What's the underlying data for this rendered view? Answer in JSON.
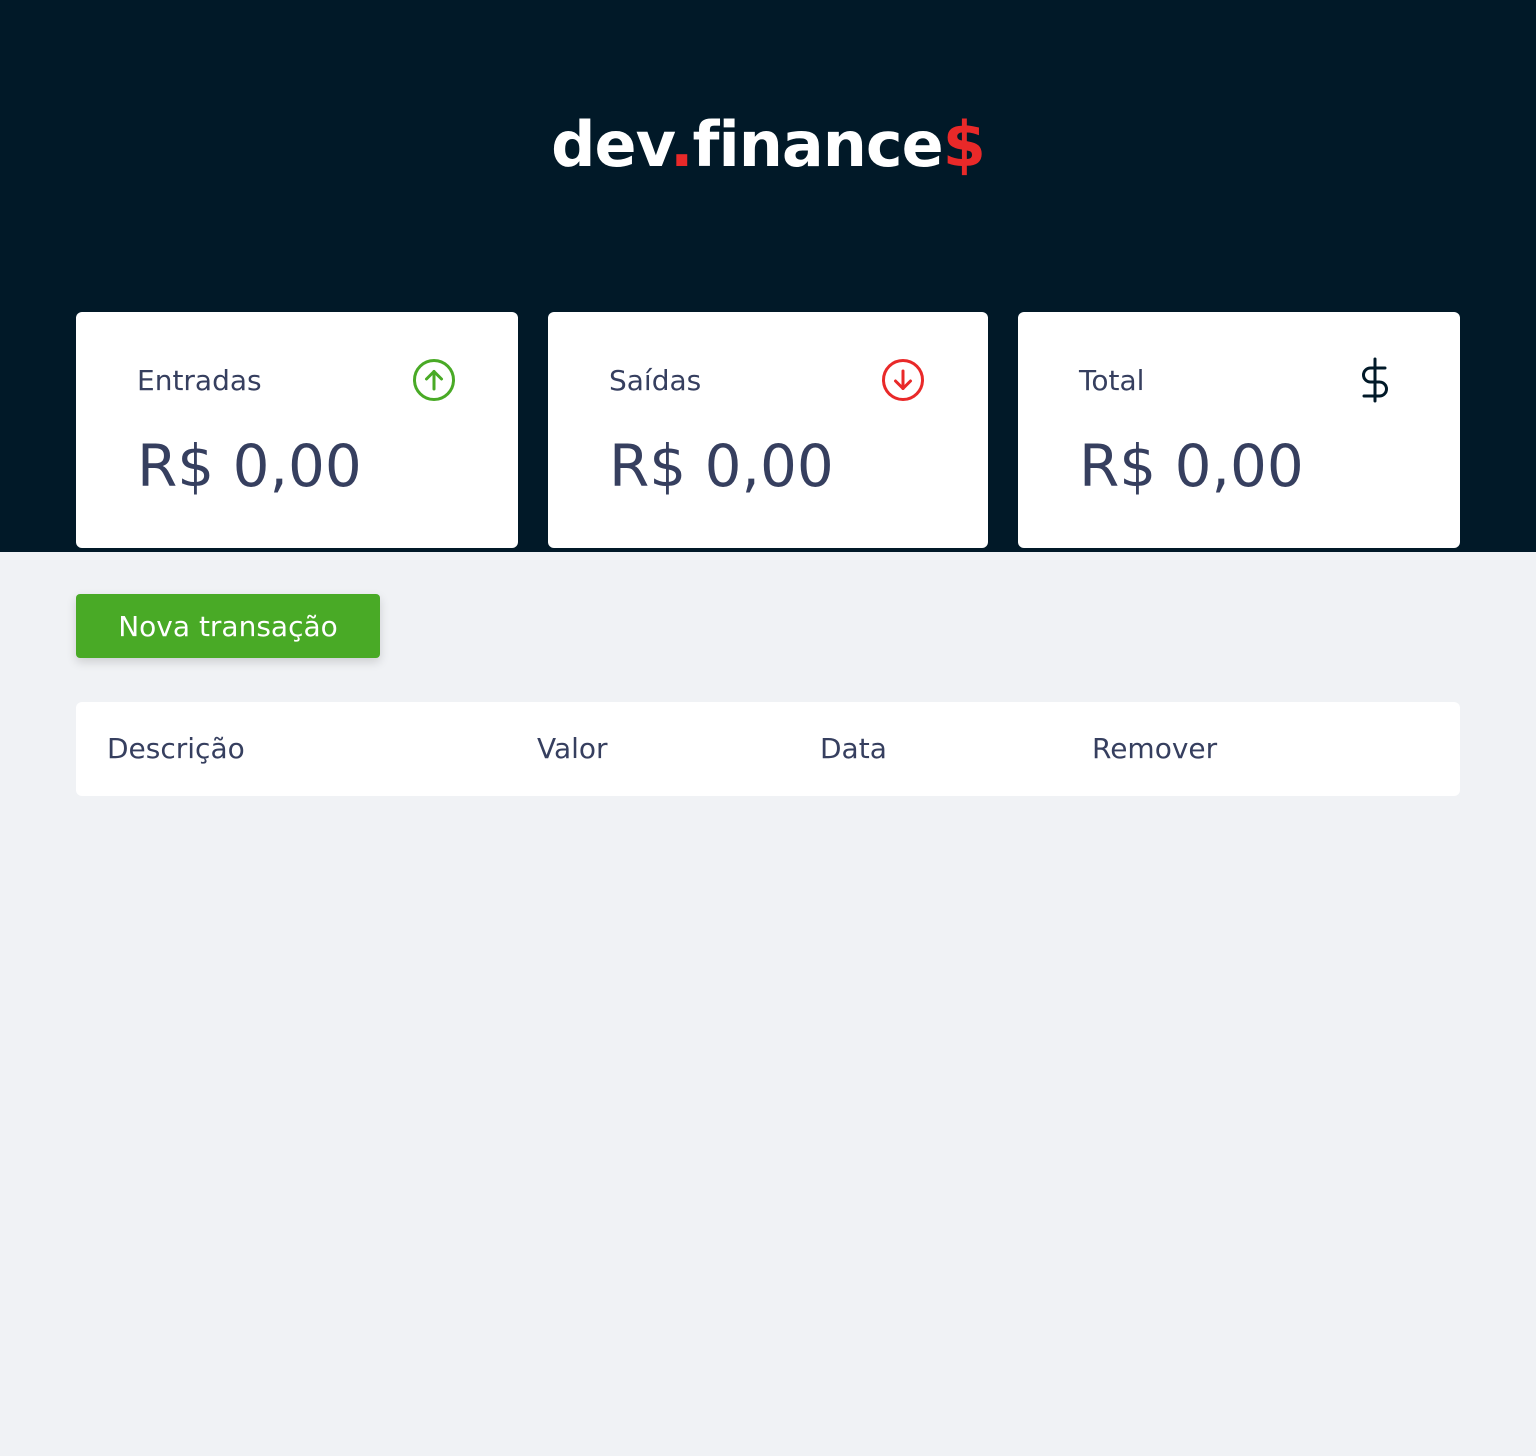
{
  "header": {
    "logo_main": "dev",
    "logo_dot": ".",
    "logo_word": "finance",
    "logo_symbol": "$"
  },
  "balance": {
    "incomes": {
      "label": "Entradas",
      "value": "R$ 0,00",
      "icon": "arrow-up-circle-icon"
    },
    "expenses": {
      "label": "Saídas",
      "value": "R$ 0,00",
      "icon": "arrow-down-circle-icon"
    },
    "total": {
      "label": "Total",
      "value": "R$ 0,00",
      "icon": "dollar-sign-icon"
    }
  },
  "actions": {
    "new_transaction_label": "Nova transação"
  },
  "table": {
    "columns": {
      "description": "Descrição",
      "amount": "Valor",
      "date": "Data",
      "remove": "Remover"
    }
  },
  "colors": {
    "header_bg": "#011928",
    "page_bg": "#f0f2f5",
    "accent_red": "#e92929",
    "accent_green": "#49aa26",
    "text": "#363f5f"
  }
}
